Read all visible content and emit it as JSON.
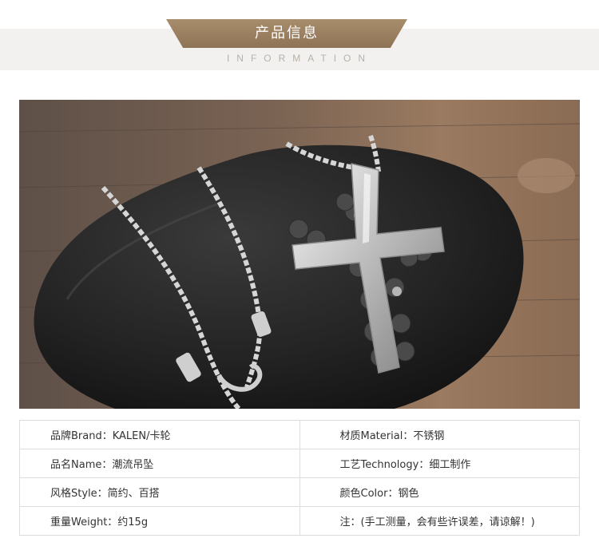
{
  "header": {
    "title": "产品信息",
    "subtitle": "INFORMATION"
  },
  "product_image": {
    "subject": "stainless-steel-cross-pendant-with-skulls-on-rope-chain"
  },
  "spec_table": {
    "rows": [
      {
        "left": "品牌Brand：KALEN/卡轮",
        "right": "材质Material：不锈钢"
      },
      {
        "left": "品名Name：潮流吊坠",
        "right": "工艺Technology：细工制作"
      },
      {
        "left": "风格Style：简约、百搭",
        "right": "颜色Color：钢色"
      },
      {
        "left": "重量Weight：约15g",
        "right": "注：(手工测量，会有些许误差，请谅解！)"
      }
    ]
  },
  "colors": {
    "header_accent": "#9a7f5f",
    "header_band": "#f3f1ef",
    "subtitle": "#b8b0a6",
    "table_border": "#dddddd"
  }
}
